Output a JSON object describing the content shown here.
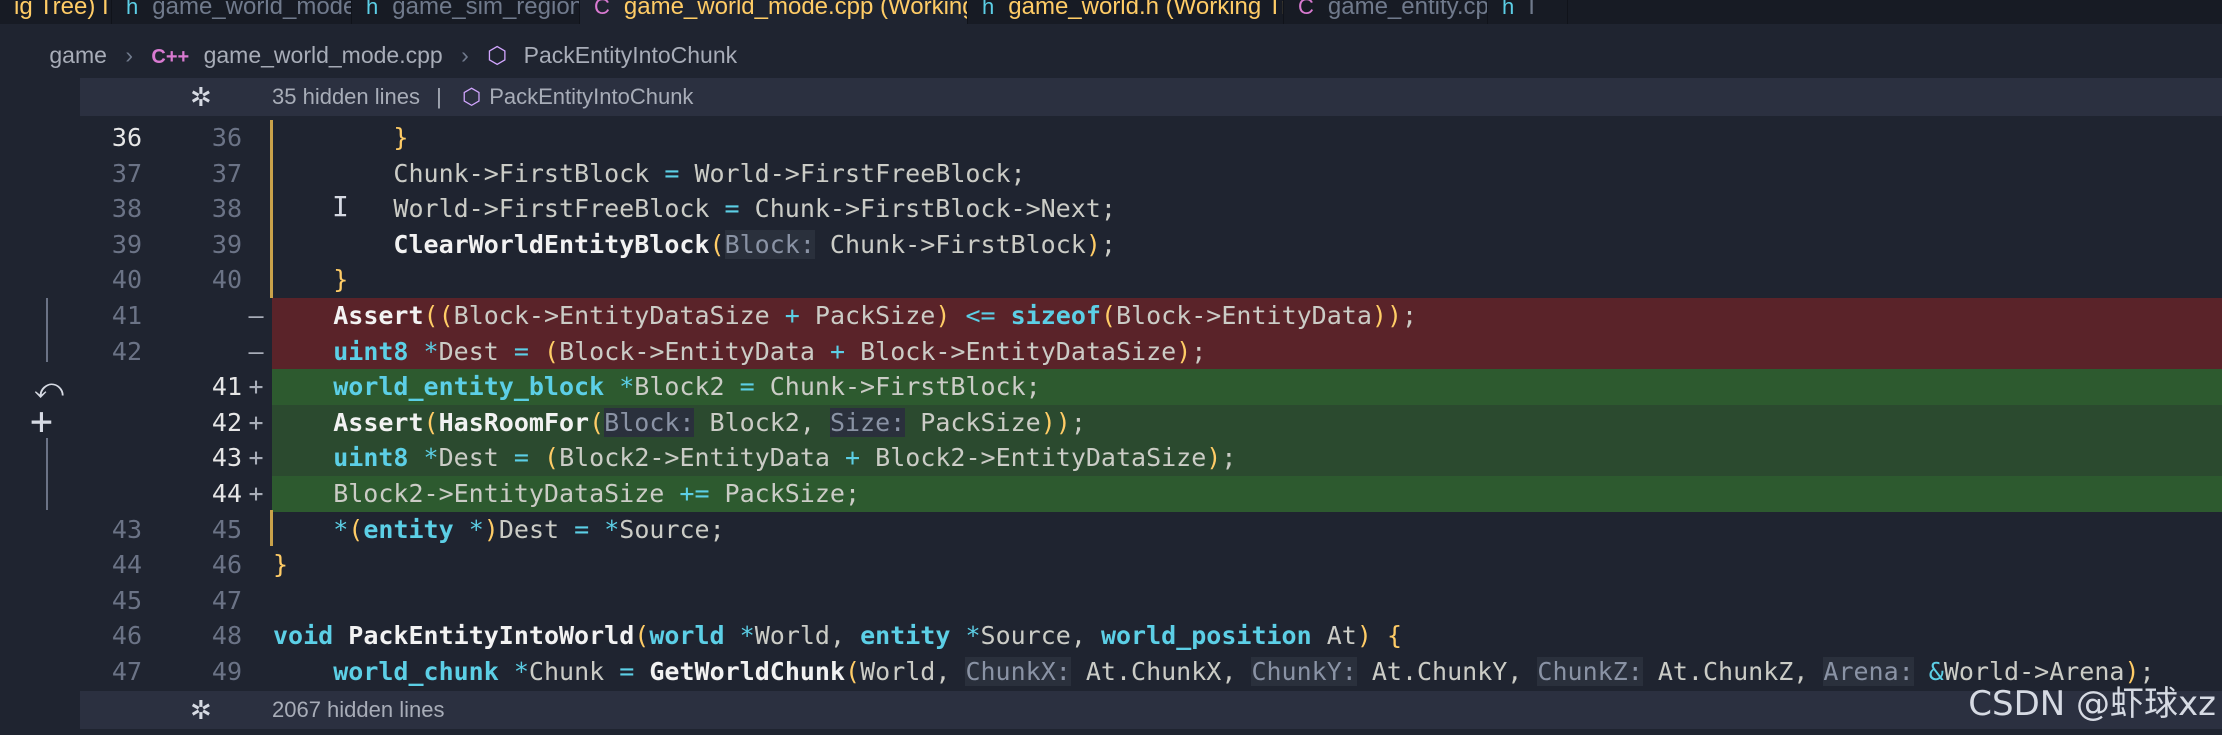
{
  "tabs": [
    {
      "label": "ig Tree) I",
      "icon": "",
      "active": false
    },
    {
      "label": "game_world_mode.h",
      "icon": "h",
      "active": false
    },
    {
      "label": "game_sim_region.h",
      "icon": "h",
      "active": false
    },
    {
      "label": "game_world_mode.cpp (Working Tree) M",
      "icon": "cpp",
      "active": true
    },
    {
      "label": "game_world.h (Working Tree) I",
      "icon": "h",
      "active": false
    },
    {
      "label": "game_entity.cpp",
      "icon": "cpp",
      "active": false
    },
    {
      "label": "I",
      "icon": "",
      "active": false
    }
  ],
  "breadcrumb": {
    "folder": "game",
    "file": "game_world_mode.cpp",
    "symbol": "PackEntityIntoChunk",
    "cpp_glyph": "C++"
  },
  "fold_top": {
    "text": "35 hidden lines",
    "separator": "|",
    "symbol": "PackEntityIntoChunk"
  },
  "fold_bottom": {
    "text": "2067 hidden lines"
  },
  "lines": [
    {
      "old": "36",
      "new": "36",
      "mark": "",
      "kind": "ctx",
      "code": "        }"
    },
    {
      "old": "37",
      "new": "37",
      "mark": "",
      "kind": "ctx",
      "code": "        Chunk->FirstBlock = World->FirstFreeBlock;"
    },
    {
      "old": "38",
      "new": "38",
      "mark": "",
      "kind": "ctx",
      "code": "        World->FirstFreeBlock = Chunk->FirstBlock->Next;"
    },
    {
      "old": "39",
      "new": "39",
      "mark": "",
      "kind": "ctx",
      "code": "        ClearWorldEntityBlock(Block: Chunk->FirstBlock);"
    },
    {
      "old": "40",
      "new": "40",
      "mark": "",
      "kind": "ctx",
      "code": "    }"
    },
    {
      "old": "41",
      "new": "",
      "mark": "—",
      "kind": "del",
      "code": "    Assert((Block->EntityDataSize + PackSize) <= sizeof(Block->EntityData));"
    },
    {
      "old": "42",
      "new": "",
      "mark": "—",
      "kind": "del",
      "code": "    uint8 *Dest = (Block->EntityData + Block->EntityDataSize);"
    },
    {
      "old": "",
      "new": "41",
      "mark": "+",
      "kind": "ins",
      "code": "    world_entity_block *Block2 = Chunk->FirstBlock;"
    },
    {
      "old": "",
      "new": "42",
      "mark": "+",
      "kind": "ins",
      "code": "    Assert(HasRoomFor(Block: Block2, Size: PackSize));"
    },
    {
      "old": "",
      "new": "43",
      "mark": "+",
      "kind": "ins",
      "code": "    uint8 *Dest = (Block2->EntityData + Block2->EntityDataSize);"
    },
    {
      "old": "",
      "new": "44",
      "mark": "+",
      "kind": "ins",
      "code": "    Block2->EntityDataSize += PackSize;"
    },
    {
      "old": "43",
      "new": "45",
      "mark": "",
      "kind": "ctx",
      "code": "    *(entity *)Dest = *Source;"
    },
    {
      "old": "44",
      "new": "46",
      "mark": "",
      "kind": "ctx",
      "code": "}"
    },
    {
      "old": "45",
      "new": "47",
      "mark": "",
      "kind": "ctx",
      "code": ""
    },
    {
      "old": "46",
      "new": "48",
      "mark": "",
      "kind": "ctx",
      "code": "void PackEntityIntoWorld(world *World, entity *Source, world_position At) {"
    },
    {
      "old": "47",
      "new": "49",
      "mark": "",
      "kind": "ctx",
      "code": "    world_chunk *Chunk = GetWorldChunk(World, ChunkX: At.ChunkX, ChunkY: At.ChunkY, ChunkZ: At.ChunkZ, Arena: &World->Arena);"
    }
  ],
  "watermark": "CSDN @虾球xz",
  "colors": {
    "background": "#1f2430",
    "deleted": "#5a2329",
    "inserted": "#2b4a2f",
    "accent": "#ffcc66"
  }
}
